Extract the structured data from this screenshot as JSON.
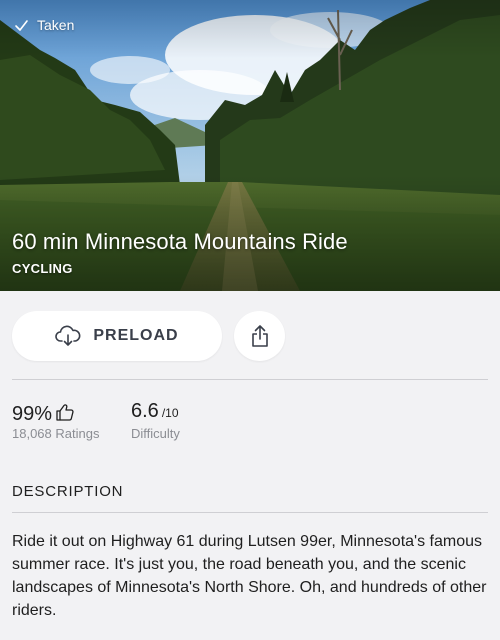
{
  "hero": {
    "status_label": "Taken",
    "title": "60 min Minnesota Mountains Ride",
    "category": "CYCLING"
  },
  "actions": {
    "preload_label": "PRELOAD"
  },
  "stats": {
    "rating_value": "99%",
    "rating_count": "18,068 Ratings",
    "difficulty_value": "6.6",
    "difficulty_unit": "/10",
    "difficulty_label": "Difficulty"
  },
  "description": {
    "heading": "DESCRIPTION",
    "body": "Ride it out on Highway 61 during Lutsen 99er, Minnesota's famous summer race. It's just you, the road beneath you, and the scenic landscapes of Minnesota's North Shore. Oh, and hundreds of other riders."
  },
  "icons": {
    "taken": "check-icon",
    "preload": "cloud-download-icon",
    "share": "share-icon",
    "rating": "thumbs-up-icon"
  },
  "colors": {
    "background": "#f2f2f4",
    "card": "#ffffff",
    "text": "#1f1f1f",
    "muted": "#8b8d93",
    "button_text": "#3a3f4a"
  }
}
